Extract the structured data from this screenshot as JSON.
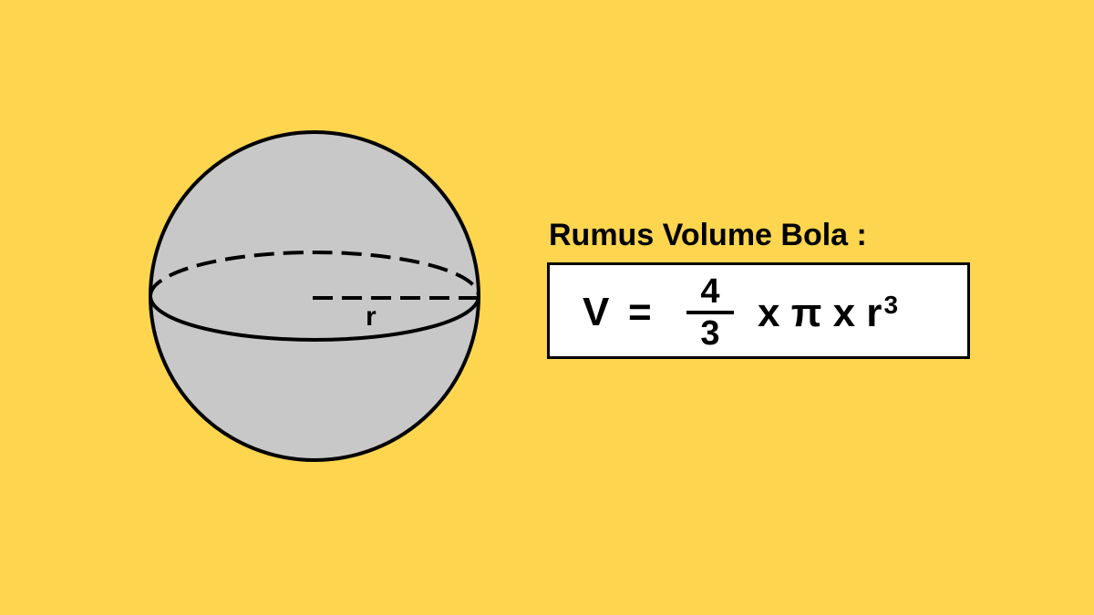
{
  "colors": {
    "background": "#fdd54f",
    "sphere_fill": "#c8c8c8",
    "stroke": "#000000",
    "box_fill": "#ffffff"
  },
  "diagram": {
    "radius_label": "r"
  },
  "formula": {
    "title": "Rumus Volume Bola :",
    "variable": "V",
    "equals": "=",
    "numerator": "4",
    "denominator": "3",
    "rest": "x π x r",
    "exponent": "3"
  }
}
